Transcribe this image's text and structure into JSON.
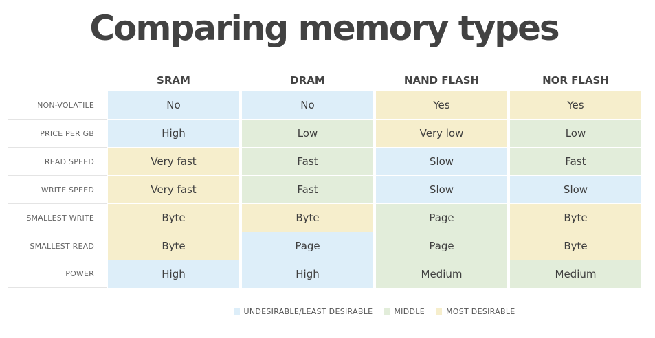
{
  "title": "Comparing memory types",
  "colors": {
    "undesirable": "#ddeef9",
    "middle": "#e2edda",
    "desirable": "#f6eecc"
  },
  "columns": [
    "SRAM",
    "DRAM",
    "NAND FLASH",
    "NOR FLASH"
  ],
  "rows": [
    {
      "label": "NON-VOLATILE",
      "cells": [
        {
          "value": "No",
          "rating": "undesirable"
        },
        {
          "value": "No",
          "rating": "undesirable"
        },
        {
          "value": "Yes",
          "rating": "desirable"
        },
        {
          "value": "Yes",
          "rating": "desirable"
        }
      ]
    },
    {
      "label": "PRICE PER GB",
      "cells": [
        {
          "value": "High",
          "rating": "undesirable"
        },
        {
          "value": "Low",
          "rating": "middle"
        },
        {
          "value": "Very low",
          "rating": "desirable"
        },
        {
          "value": "Low",
          "rating": "middle"
        }
      ]
    },
    {
      "label": "READ SPEED",
      "cells": [
        {
          "value": "Very fast",
          "rating": "desirable"
        },
        {
          "value": "Fast",
          "rating": "middle"
        },
        {
          "value": "Slow",
          "rating": "undesirable"
        },
        {
          "value": "Fast",
          "rating": "middle"
        }
      ]
    },
    {
      "label": "WRITE SPEED",
      "cells": [
        {
          "value": "Very fast",
          "rating": "desirable"
        },
        {
          "value": "Fast",
          "rating": "middle"
        },
        {
          "value": "Slow",
          "rating": "undesirable"
        },
        {
          "value": "Slow",
          "rating": "undesirable"
        }
      ]
    },
    {
      "label": "SMALLEST WRITE",
      "cells": [
        {
          "value": "Byte",
          "rating": "desirable"
        },
        {
          "value": "Byte",
          "rating": "desirable"
        },
        {
          "value": "Page",
          "rating": "middle"
        },
        {
          "value": "Byte",
          "rating": "desirable"
        }
      ]
    },
    {
      "label": "SMALLEST READ",
      "cells": [
        {
          "value": "Byte",
          "rating": "desirable"
        },
        {
          "value": "Page",
          "rating": "undesirable"
        },
        {
          "value": "Page",
          "rating": "middle"
        },
        {
          "value": "Byte",
          "rating": "desirable"
        }
      ]
    },
    {
      "label": "POWER",
      "cells": [
        {
          "value": "High",
          "rating": "undesirable"
        },
        {
          "value": "High",
          "rating": "undesirable"
        },
        {
          "value": "Medium",
          "rating": "middle"
        },
        {
          "value": "Medium",
          "rating": "middle"
        }
      ]
    }
  ],
  "legend": [
    {
      "key": "undesirable",
      "label": "UNDESIRABLE/LEAST DESIRABLE"
    },
    {
      "key": "middle",
      "label": "MIDDLE"
    },
    {
      "key": "desirable",
      "label": "MOST DESIRABLE"
    }
  ]
}
